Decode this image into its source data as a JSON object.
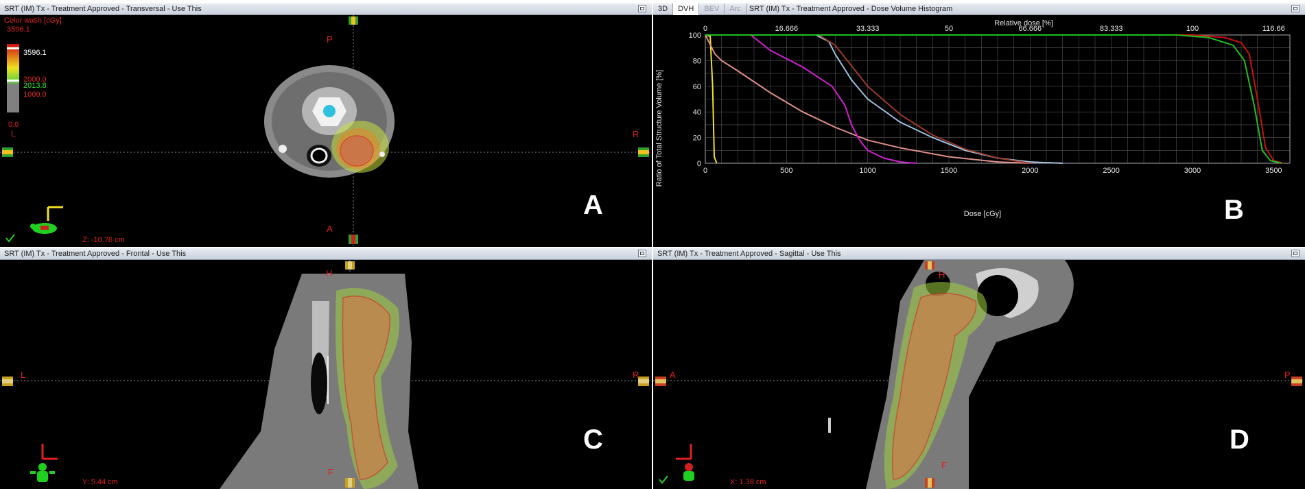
{
  "panels": {
    "transversal": {
      "title": "SRT (IM) Tx  -  Treatment Approved - Transversal - Use This",
      "colorwash_label": "Color wash [cGy]",
      "scale_max": "3596.1",
      "scale_top": "3596.1",
      "scale_mid_green": "2013.8",
      "scale_mid_red": "2000.0",
      "scale_low": "1000.0",
      "scale_zero": "0.0",
      "orient_top": "P",
      "orient_bottom": "A",
      "orient_left": "L",
      "orient_right": "R",
      "coord": "Z: -10.76 cm",
      "panel_letter": "A"
    },
    "dvh": {
      "tabs": [
        "3D",
        "DVH",
        "BEV",
        "Arc"
      ],
      "title": "SRT (IM) Tx  -  Treatment Approved - Dose Volume Histogram",
      "top_axis_label": "Relative dose [%]",
      "top_ticks": [
        "0",
        "16.666",
        "33.333",
        "50",
        "66.666",
        "83.333",
        "100",
        "116.66"
      ],
      "bottom_axis_label": "Dose [cGy]",
      "bottom_ticks": [
        "0",
        "500",
        "1000",
        "1500",
        "2000",
        "2500",
        "3000",
        "3500"
      ],
      "y_axis_label": "Ratio of Total Structure Volume [%]",
      "y_ticks": [
        "0",
        "20",
        "40",
        "60",
        "80",
        "100"
      ],
      "panel_letter": "B"
    },
    "frontal": {
      "title": "SRT (IM) Tx  -  Treatment Approved - Frontal - Use This",
      "orient_top": "H",
      "orient_bottom": "F",
      "orient_left": "L",
      "orient_right": "R",
      "coord": "Y: 5.44 cm",
      "panel_letter": "C"
    },
    "sagittal": {
      "title": "SRT (IM) Tx  -  Treatment Approved - Sagittal - Use This",
      "orient_top": "H",
      "orient_bottom": "F",
      "orient_left": "A",
      "orient_right": "P",
      "coord": "X: 1.38 cm",
      "panel_letter": "D"
    }
  },
  "chart_data": {
    "type": "line",
    "title": "",
    "xlabel": "Dose [cGy]",
    "ylabel": "Ratio of Total Structure Volume [%]",
    "x2label": "Relative dose [%]",
    "xlim": [
      0,
      3600
    ],
    "ylim": [
      0,
      100
    ],
    "grid": true,
    "series": [
      {
        "color": "#f0e020",
        "x": [
          0,
          30,
          45,
          55,
          70
        ],
        "y": [
          100,
          99,
          60,
          5,
          0
        ]
      },
      {
        "color": "#e0908a",
        "x": [
          0,
          60,
          100,
          200,
          400,
          600,
          800,
          1000,
          1200,
          1500,
          1800,
          2000
        ],
        "y": [
          100,
          85,
          80,
          72,
          55,
          40,
          28,
          18,
          12,
          5,
          1,
          0
        ]
      },
      {
        "color": "#d020d0",
        "x": [
          0,
          280,
          400,
          600,
          780,
          860,
          900,
          950,
          1000,
          1100,
          1200,
          1300
        ],
        "y": [
          100,
          100,
          88,
          75,
          60,
          45,
          30,
          18,
          10,
          4,
          1,
          0
        ]
      },
      {
        "color": "#a0c0e0",
        "x": [
          0,
          680,
          760,
          800,
          900,
          1000,
          1200,
          1400,
          1600,
          1800,
          2000,
          2200
        ],
        "y": [
          100,
          100,
          95,
          85,
          65,
          50,
          32,
          20,
          10,
          4,
          1,
          0
        ]
      },
      {
        "color": "#9b3a2a",
        "x": [
          0,
          700,
          800,
          900,
          1000,
          1200,
          1400,
          1600,
          1800,
          2000
        ],
        "y": [
          100,
          100,
          92,
          76,
          60,
          38,
          22,
          11,
          4,
          0
        ]
      },
      {
        "color": "#cc1010",
        "x": [
          0,
          3000,
          3200,
          3300,
          3350,
          3400,
          3450,
          3500,
          3560
        ],
        "y": [
          100,
          100,
          98,
          94,
          85,
          50,
          12,
          2,
          0
        ]
      },
      {
        "color": "#20c020",
        "x": [
          0,
          2900,
          3100,
          3250,
          3320,
          3380,
          3430,
          3480,
          3550
        ],
        "y": [
          100,
          100,
          98,
          92,
          80,
          45,
          10,
          2,
          0
        ]
      }
    ]
  }
}
